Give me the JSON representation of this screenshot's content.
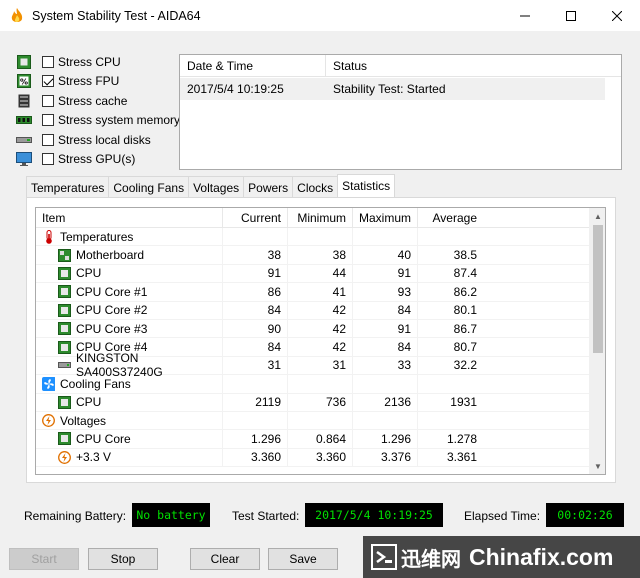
{
  "window": {
    "title": "System Stability Test - AIDA64"
  },
  "stress_options": [
    {
      "label": "Stress CPU",
      "checked": false,
      "icon": "cpu-chip-icon"
    },
    {
      "label": "Stress FPU",
      "checked": true,
      "icon": "fpu-chip-icon"
    },
    {
      "label": "Stress cache",
      "checked": false,
      "icon": "cache-icon"
    },
    {
      "label": "Stress system memory",
      "checked": false,
      "icon": "memory-module-icon"
    },
    {
      "label": "Stress local disks",
      "checked": false,
      "icon": "disk-drive-icon"
    },
    {
      "label": "Stress GPU(s)",
      "checked": false,
      "icon": "monitor-icon"
    }
  ],
  "status_table": {
    "headers": [
      "Date & Time",
      "Status"
    ],
    "rows": [
      [
        "2017/5/4 10:19:25",
        "Stability Test: Started"
      ]
    ]
  },
  "tabs": [
    "Temperatures",
    "Cooling Fans",
    "Voltages",
    "Powers",
    "Clocks",
    "Statistics"
  ],
  "active_tab": "Statistics",
  "stats": {
    "headers": [
      "Item",
      "Current",
      "Minimum",
      "Maximum",
      "Average"
    ],
    "rows": [
      {
        "type": "group",
        "icon": "thermometer-icon",
        "item": "Temperatures"
      },
      {
        "type": "item",
        "icon": "motherboard-icon",
        "item": "Motherboard",
        "cur": "38",
        "min": "38",
        "max": "40",
        "avg": "38.5"
      },
      {
        "type": "item",
        "icon": "cpu-chip-icon",
        "item": "CPU",
        "cur": "91",
        "min": "44",
        "max": "91",
        "avg": "87.4"
      },
      {
        "type": "item",
        "icon": "cpu-chip-icon",
        "item": "CPU Core #1",
        "cur": "86",
        "min": "41",
        "max": "93",
        "avg": "86.2"
      },
      {
        "type": "item",
        "icon": "cpu-chip-icon",
        "item": "CPU Core #2",
        "cur": "84",
        "min": "42",
        "max": "84",
        "avg": "80.1"
      },
      {
        "type": "item",
        "icon": "cpu-chip-icon",
        "item": "CPU Core #3",
        "cur": "90",
        "min": "42",
        "max": "91",
        "avg": "86.7"
      },
      {
        "type": "item",
        "icon": "cpu-chip-icon",
        "item": "CPU Core #4",
        "cur": "84",
        "min": "42",
        "max": "84",
        "avg": "80.7"
      },
      {
        "type": "item",
        "icon": "disk-drive-icon",
        "item": "KINGSTON SA400S37240G",
        "cur": "31",
        "min": "31",
        "max": "33",
        "avg": "32.2"
      },
      {
        "type": "group",
        "icon": "fan-icon",
        "item": "Cooling Fans"
      },
      {
        "type": "item",
        "icon": "cpu-chip-icon",
        "item": "CPU",
        "cur": "2119",
        "min": "736",
        "max": "2136",
        "avg": "1931"
      },
      {
        "type": "group",
        "icon": "voltage-icon",
        "item": "Voltages"
      },
      {
        "type": "item",
        "icon": "cpu-chip-icon",
        "item": "CPU Core",
        "cur": "1.296",
        "min": "0.864",
        "max": "1.296",
        "avg": "1.278"
      },
      {
        "type": "item",
        "icon": "voltage-icon",
        "item": "+3.3 V",
        "cur": "3.360",
        "min": "3.360",
        "max": "3.376",
        "avg": "3.361"
      }
    ]
  },
  "bottom": {
    "battery_label": "Remaining Battery:",
    "battery_value": "No battery",
    "started_label": "Test Started:",
    "started_value": "2017/5/4 10:19:25",
    "elapsed_label": "Elapsed Time:",
    "elapsed_value": "00:02:26"
  },
  "buttons": {
    "start": "Start",
    "stop": "Stop",
    "clear": "Clear",
    "save": "Save"
  },
  "watermark": {
    "cn": "迅维网",
    "en": "Chinafix.com"
  },
  "colors": {
    "lcd_bg": "#000000",
    "lcd_text": "#00e000",
    "chip_green": "#2e8b2e",
    "fan_blue": "#1e90ff",
    "voltage_orange": "#e07000"
  }
}
